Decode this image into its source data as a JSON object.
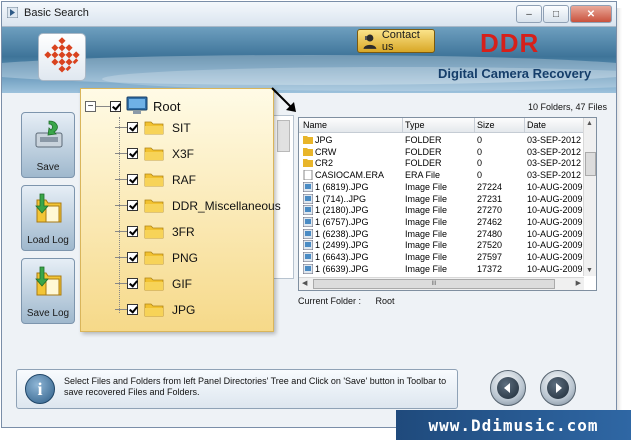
{
  "window": {
    "title": "Basic Search",
    "min": "–",
    "max": "□",
    "close": "✕"
  },
  "header": {
    "contact_label": "Contact us",
    "brand": "DDR",
    "subtitle": "Digital Camera Recovery"
  },
  "sidebar": [
    {
      "label": "Save",
      "icon": "save-icon"
    },
    {
      "label": "Load Log",
      "icon": "load-log-icon"
    },
    {
      "label": "Save Log",
      "icon": "save-log-icon"
    }
  ],
  "tree": {
    "root": "Root",
    "expander": "−",
    "items": [
      "SIT",
      "X3F",
      "RAF",
      "DDR_Miscellaneous",
      "3FR",
      "PNG",
      "GIF",
      "JPG"
    ]
  },
  "file_list": {
    "summary": "10 Folders, 47 Files",
    "columns": [
      "Name",
      "Type",
      "Size",
      "Date"
    ],
    "rows": [
      {
        "name": "JPG",
        "type": "FOLDER",
        "size": "0",
        "date": "03-SEP-2012",
        "icon": "folder"
      },
      {
        "name": "CRW",
        "type": "FOLDER",
        "size": "0",
        "date": "03-SEP-2012",
        "icon": "folder"
      },
      {
        "name": "CR2",
        "type": "FOLDER",
        "size": "0",
        "date": "03-SEP-2012",
        "icon": "folder"
      },
      {
        "name": "CASIOCAM.ERA",
        "type": "ERA File",
        "size": "0",
        "date": "03-SEP-2012",
        "icon": "file"
      },
      {
        "name": "1 (6819).JPG",
        "type": "Image File",
        "size": "27224",
        "date": "10-AUG-2009",
        "icon": "image"
      },
      {
        "name": "1 (714)..JPG",
        "type": "Image File",
        "size": "27231",
        "date": "10-AUG-2009",
        "icon": "image"
      },
      {
        "name": "1 (2180).JPG",
        "type": "Image File",
        "size": "27270",
        "date": "10-AUG-2009",
        "icon": "image"
      },
      {
        "name": "1 (6757).JPG",
        "type": "Image File",
        "size": "27462",
        "date": "10-AUG-2009",
        "icon": "image"
      },
      {
        "name": "1 (6238).JPG",
        "type": "Image File",
        "size": "27480",
        "date": "10-AUG-2009",
        "icon": "image"
      },
      {
        "name": "1 (2499).JPG",
        "type": "Image File",
        "size": "27520",
        "date": "10-AUG-2009",
        "icon": "image"
      },
      {
        "name": "1 (6643).JPG",
        "type": "Image File",
        "size": "27597",
        "date": "10-AUG-2009",
        "icon": "image"
      },
      {
        "name": "1 (6639).JPG",
        "type": "Image File",
        "size": "17372",
        "date": "10-AUG-2009",
        "icon": "image"
      }
    ],
    "hscroll_grip": "III"
  },
  "current_folder": {
    "label": "Current Folder :",
    "value": "Root"
  },
  "info": {
    "icon_text": "i",
    "text": "Select Files and Folders from left Panel Directories' Tree and Click on 'Save' button in Toolbar to save recovered Files and Folders."
  },
  "watermark": "www.Ddimusic.com"
}
